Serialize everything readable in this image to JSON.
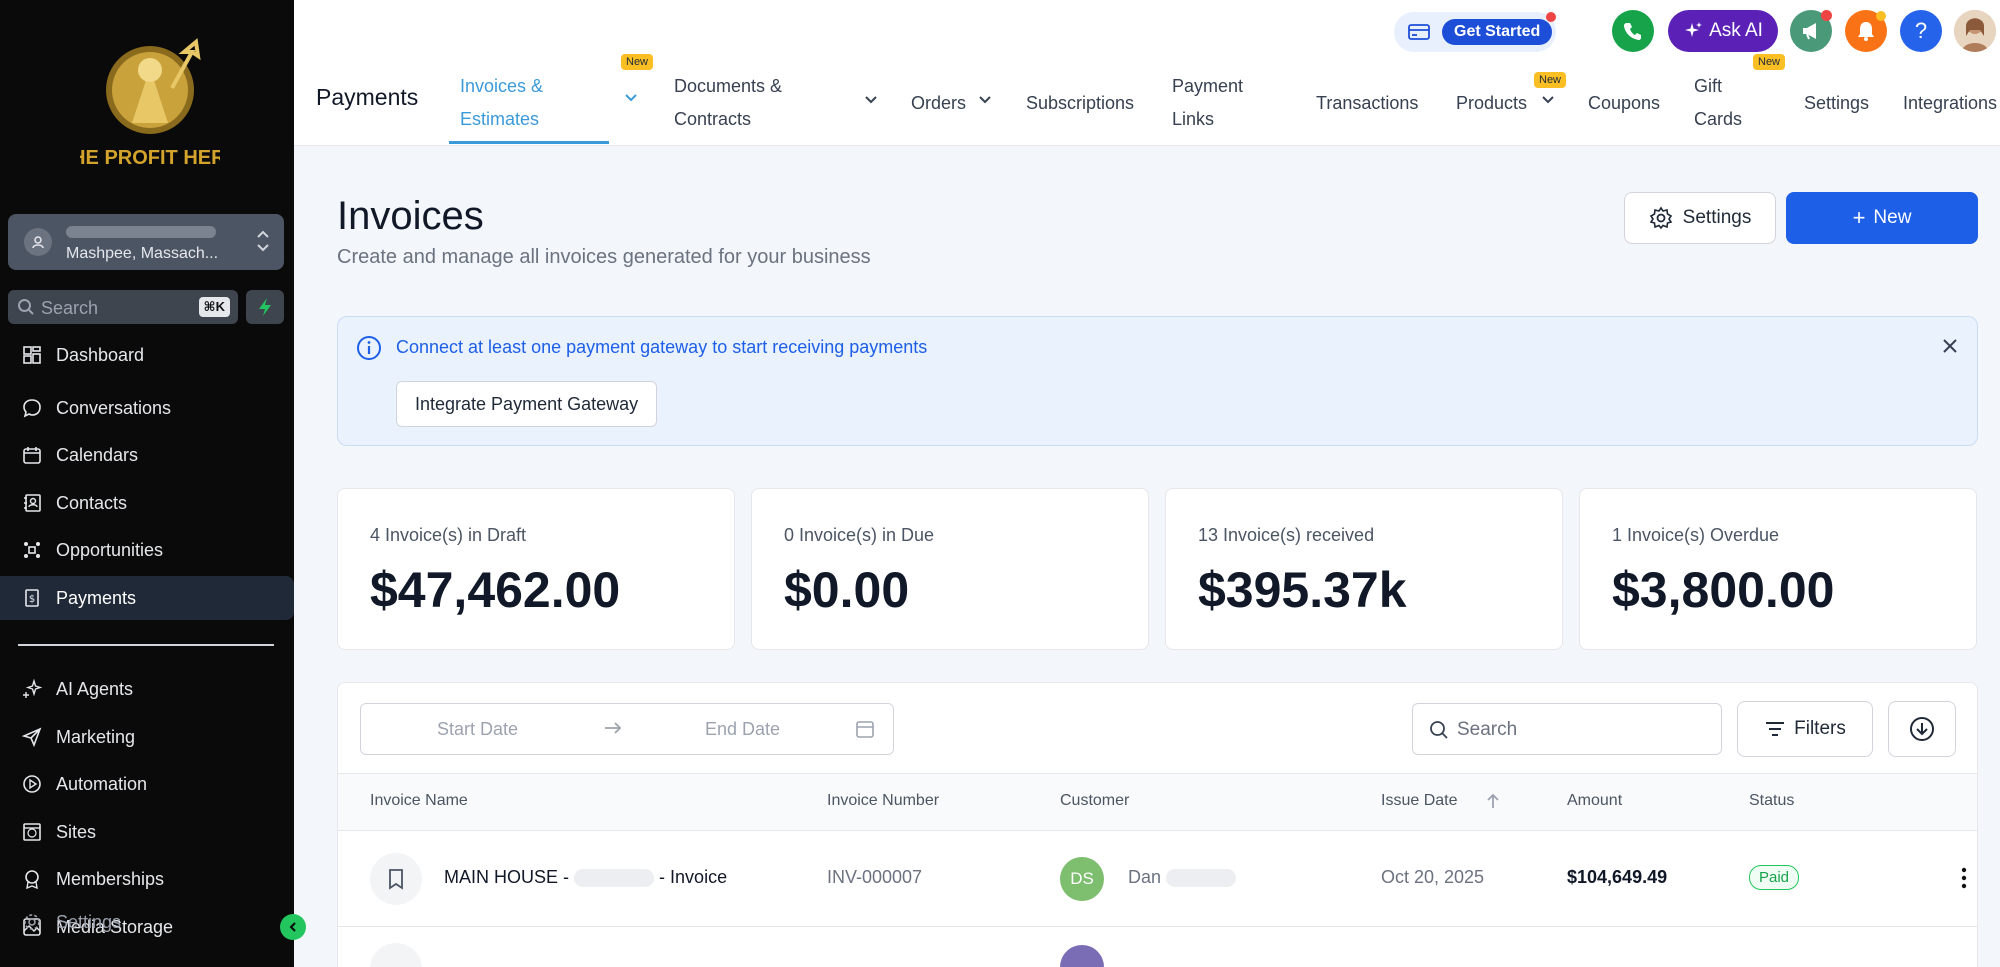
{
  "sidebar": {
    "logo_text": "THE PROFIT HERO",
    "account": {
      "location": "Mashpee, Massach..."
    },
    "search": {
      "placeholder": "Search",
      "shortcut": "⌘K"
    },
    "items": [
      {
        "label": "Dashboard",
        "icon": "dashboard-icon"
      },
      {
        "label": "Conversations",
        "icon": "chat-icon"
      },
      {
        "label": "Calendars",
        "icon": "calendar-icon"
      },
      {
        "label": "Contacts",
        "icon": "contacts-icon"
      },
      {
        "label": "Opportunities",
        "icon": "opportunities-icon"
      },
      {
        "label": "Payments",
        "icon": "payments-icon",
        "active": true
      },
      {
        "label": "AI Agents",
        "icon": "sparkle-icon"
      },
      {
        "label": "Marketing",
        "icon": "send-icon"
      },
      {
        "label": "Automation",
        "icon": "automation-icon"
      },
      {
        "label": "Sites",
        "icon": "globe-icon"
      },
      {
        "label": "Memberships",
        "icon": "badge-icon"
      },
      {
        "label": "Media Storage",
        "icon": "media-icon"
      },
      {
        "label": "Settings",
        "icon": "gear-icon"
      }
    ]
  },
  "header": {
    "get_started": "Get Started",
    "ask_ai": "Ask AI",
    "page_title": "Payments",
    "new_badge": "New",
    "tabs": [
      {
        "line1": "Invoices &",
        "line2": "Estimates",
        "active": true
      },
      {
        "line1": "Documents &",
        "line2": "Contracts"
      },
      {
        "label": "Orders"
      },
      {
        "label": "Subscriptions"
      },
      {
        "line1": "Payment",
        "line2": "Links"
      },
      {
        "label": "Transactions"
      },
      {
        "label": "Products"
      },
      {
        "label": "Coupons"
      },
      {
        "line1": "Gift",
        "line2": "Cards"
      },
      {
        "label": "Settings"
      },
      {
        "label": "Integrations"
      }
    ]
  },
  "main": {
    "title": "Invoices",
    "subtitle": "Create and manage all invoices generated for your business",
    "settings_label": "Settings",
    "new_label": "New",
    "alert": {
      "message": "Connect at least one payment gateway to start receiving payments",
      "button": "Integrate Payment Gateway"
    },
    "stats": [
      {
        "label": "4 Invoice(s) in Draft",
        "value": "$47,462.00"
      },
      {
        "label": "0 Invoice(s) in Due",
        "value": "$0.00"
      },
      {
        "label": "13 Invoice(s) received",
        "value": "$395.37k"
      },
      {
        "label": "1 Invoice(s) Overdue",
        "value": "$3,800.00"
      }
    ],
    "table": {
      "start_date": "Start Date",
      "end_date": "End Date",
      "search_placeholder": "Search",
      "filters_label": "Filters",
      "columns": [
        "Invoice Name",
        "Invoice Number",
        "Customer",
        "Issue Date",
        "Amount",
        "Status"
      ],
      "rows": [
        {
          "name_prefix": "MAIN HOUSE -",
          "name_suffix": "- Invoice",
          "number": "INV-000007",
          "customer_initials": "DS",
          "customer_name": "Dan",
          "issue_date": "Oct 20, 2025",
          "amount": "$104,649.49",
          "status": "Paid"
        }
      ]
    }
  },
  "colors": {
    "sidebar_bg": "#0a0a0a",
    "accent_blue": "#1d5fe6",
    "tab_active": "#3b9ad9",
    "paid_green": "#16a34a",
    "ask_ai_purple": "#5b21b6"
  }
}
